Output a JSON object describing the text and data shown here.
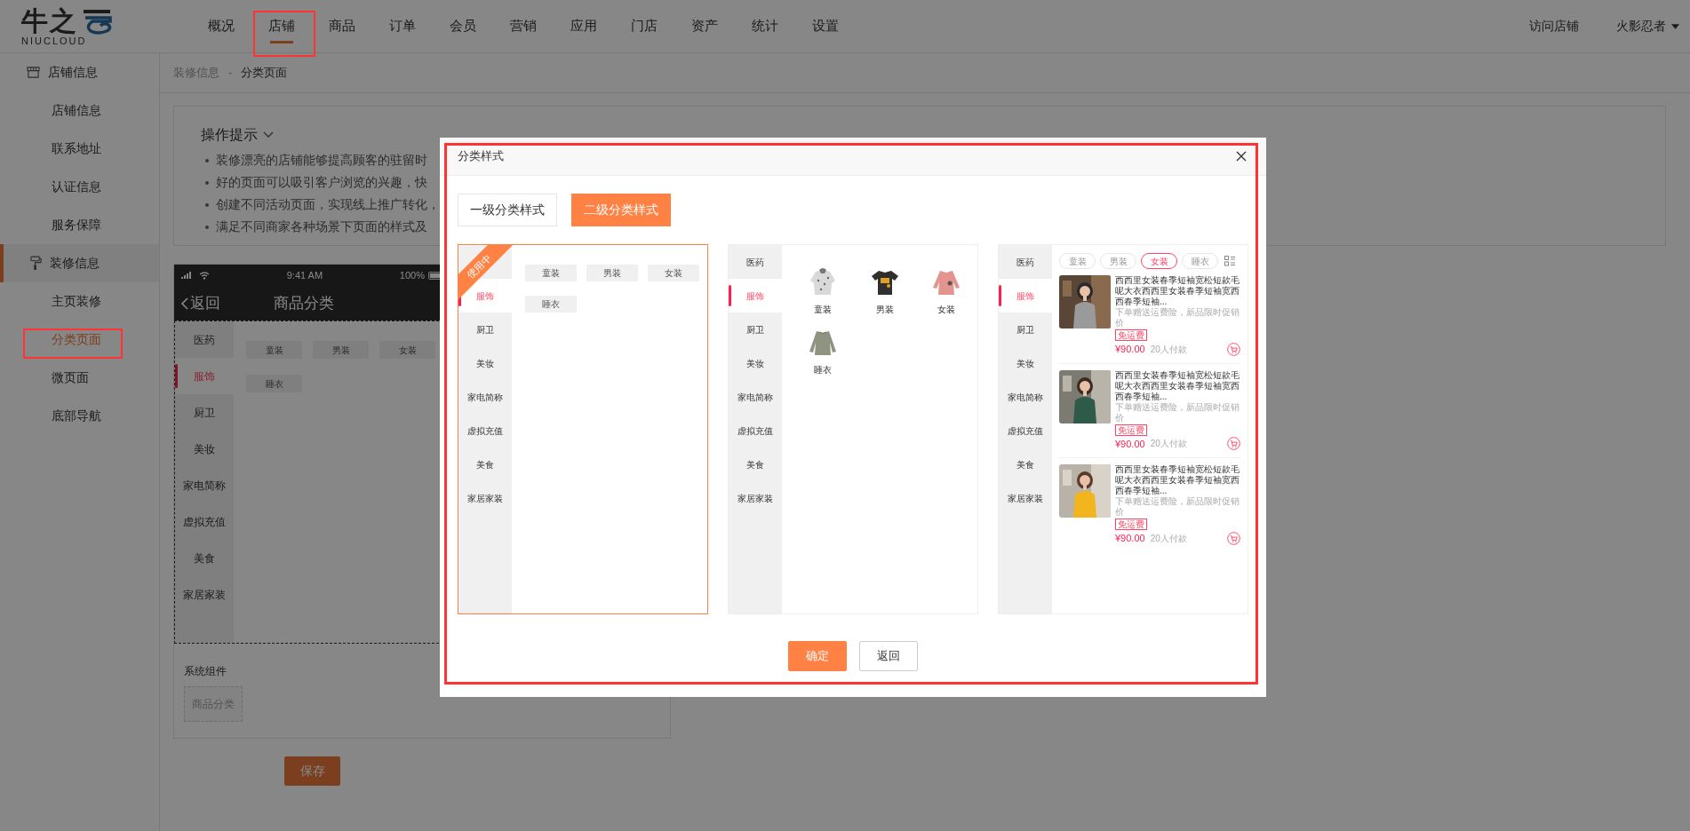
{
  "logo": {
    "name": "牛之",
    "sub": "NIUCLOUD"
  },
  "nav": [
    {
      "label": "概况",
      "selected": false
    },
    {
      "label": "店铺",
      "selected": true
    },
    {
      "label": "商品",
      "selected": false
    },
    {
      "label": "订单",
      "selected": false
    },
    {
      "label": "会员",
      "selected": false
    },
    {
      "label": "营销",
      "selected": false
    },
    {
      "label": "应用",
      "selected": false
    },
    {
      "label": "门店",
      "selected": false
    },
    {
      "label": "资产",
      "selected": false
    },
    {
      "label": "统计",
      "selected": false
    },
    {
      "label": "设置",
      "selected": false
    }
  ],
  "header_links": {
    "visit_store": "访问店铺",
    "user": "火影忍者"
  },
  "sidebar": {
    "groups": [
      {
        "title": "店铺信息",
        "selected": false,
        "items": [
          {
            "label": "店铺信息",
            "selected": false
          },
          {
            "label": "联系地址",
            "selected": false
          },
          {
            "label": "认证信息",
            "selected": false
          },
          {
            "label": "服务保障",
            "selected": false
          }
        ]
      },
      {
        "title": "装修信息",
        "selected": true,
        "items": [
          {
            "label": "主页装修",
            "selected": false
          },
          {
            "label": "分类页面",
            "selected": true
          },
          {
            "label": "微页面",
            "selected": false
          },
          {
            "label": "底部导航",
            "selected": false
          }
        ]
      }
    ]
  },
  "breadcrumb": {
    "items": [
      "装修信息",
      "分类页面"
    ],
    "separator": "-"
  },
  "tips": {
    "title": "操作提示",
    "items": [
      "装修漂亮的店铺能够提高顾客的驻留时",
      "好的页面可以吸引客户浏览的兴趣，快",
      "创建不同活动页面，实现线上推广转化，",
      "满足不同商家各种场景下页面的样式及"
    ]
  },
  "phone_preview": {
    "time": "9:41 AM",
    "battery": "100%",
    "back": "返回",
    "title": "商品分类",
    "categories": [
      {
        "label": "医药",
        "selected": false
      },
      {
        "label": "服饰",
        "selected": true
      },
      {
        "label": "厨卫",
        "selected": false
      },
      {
        "label": "美妆",
        "selected": false
      },
      {
        "label": "家电简称",
        "selected": false
      },
      {
        "label": "虚拟充值",
        "selected": false
      },
      {
        "label": "美食",
        "selected": false
      },
      {
        "label": "家居家装",
        "selected": false
      }
    ],
    "subcategories": [
      "童装",
      "男装",
      "女装",
      "睡衣"
    ]
  },
  "system_components": {
    "title": "系统组件",
    "items": [
      "商品分类"
    ]
  },
  "save_button": "保存",
  "dialog": {
    "title": "分类样式",
    "tabs": [
      {
        "label": "一级分类样式",
        "selected": false
      },
      {
        "label": "二级分类样式",
        "selected": true
      }
    ],
    "styles": [
      {
        "kind": "chips",
        "in_use": true,
        "badge": "使用中",
        "categories": [
          {
            "label": "服饰",
            "selected": true
          },
          {
            "label": "厨卫",
            "selected": false
          },
          {
            "label": "美妆",
            "selected": false
          },
          {
            "label": "家电简称",
            "selected": false
          },
          {
            "label": "虚拟充值",
            "selected": false
          },
          {
            "label": "美食",
            "selected": false
          },
          {
            "label": "家居家装",
            "selected": false
          }
        ],
        "subcategories": [
          "童装",
          "男装",
          "女装",
          "睡衣"
        ]
      },
      {
        "kind": "images",
        "in_use": false,
        "categories": [
          {
            "label": "医药",
            "selected": false
          },
          {
            "label": "服饰",
            "selected": true
          },
          {
            "label": "厨卫",
            "selected": false
          },
          {
            "label": "美妆",
            "selected": false
          },
          {
            "label": "家电简称",
            "selected": false
          },
          {
            "label": "虚拟充值",
            "selected": false
          },
          {
            "label": "美食",
            "selected": false
          },
          {
            "label": "家居家装",
            "selected": false
          }
        ],
        "subcategories": [
          "童装",
          "男装",
          "女装",
          "睡衣"
        ]
      },
      {
        "kind": "products",
        "in_use": false,
        "categories": [
          {
            "label": "医药",
            "selected": false
          },
          {
            "label": "服饰",
            "selected": true
          },
          {
            "label": "厨卫",
            "selected": false
          },
          {
            "label": "美妆",
            "selected": false
          },
          {
            "label": "家电简称",
            "selected": false
          },
          {
            "label": "虚拟充值",
            "selected": false
          },
          {
            "label": "美食",
            "selected": false
          },
          {
            "label": "家居家装",
            "selected": false
          }
        ],
        "filters": [
          {
            "label": "童装",
            "selected": false
          },
          {
            "label": "男装",
            "selected": false
          },
          {
            "label": "女装",
            "selected": true
          },
          {
            "label": "睡衣",
            "selected": false
          }
        ],
        "products": [
          {
            "title": "西西里女装春季短袖宽松短款毛呢大衣西西里女装春季短袖宽西西春季短袖...",
            "subtitle": "下单赠送运费险，新品限时促销价",
            "tag": "免运费",
            "price": "¥90.00",
            "sales": "20人付款"
          },
          {
            "title": "西西里女装春季短袖宽松短款毛呢大衣西西里女装春季短袖宽西西春季短袖...",
            "subtitle": "下单赠送运费险，新品限时促销价",
            "tag": "免运费",
            "price": "¥90.00",
            "sales": "20人付款"
          },
          {
            "title": "西西里女装春季短袖宽松短款毛呢大衣西西里女装春季短袖宽西西春季短袖...",
            "subtitle": "下单赠送运费险，新品限时促销价",
            "tag": "免运费",
            "price": "¥90.00",
            "sales": "20人付款"
          }
        ]
      }
    ],
    "buttons": [
      {
        "label": "确定",
        "kind": "primary"
      },
      {
        "label": "返回",
        "kind": "default"
      }
    ]
  }
}
